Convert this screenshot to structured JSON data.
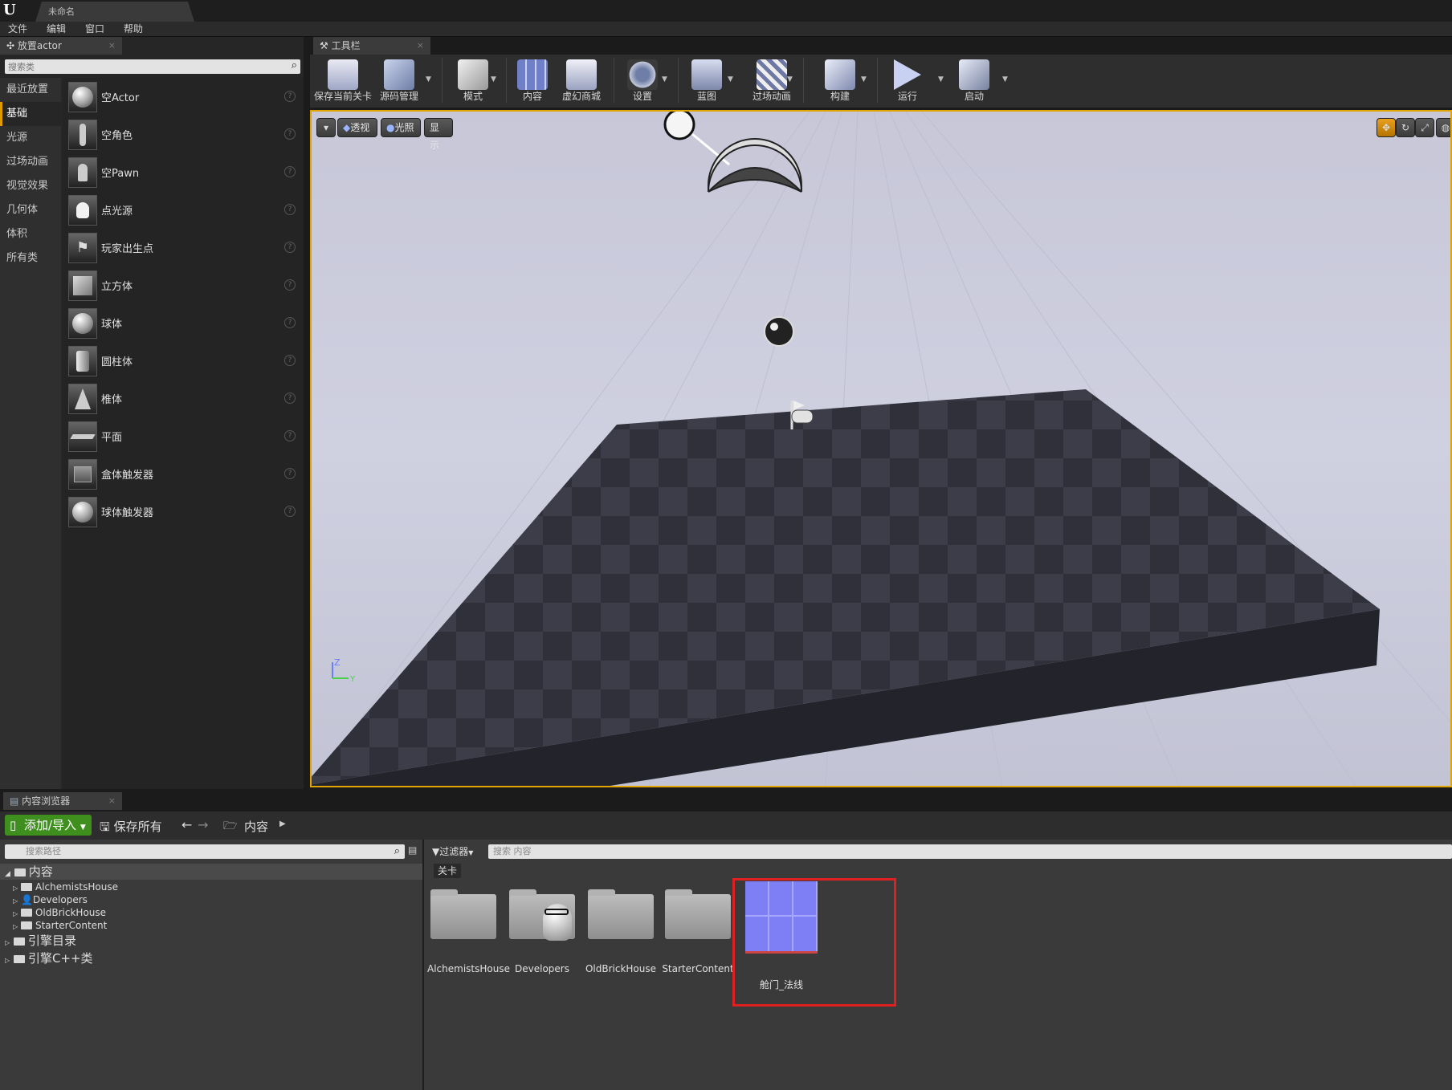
{
  "titlebar": {
    "doc_tab": "未命名"
  },
  "menu": [
    "文件",
    "编辑",
    "窗口",
    "帮助"
  ],
  "place_panel": {
    "tab_label": "放置actor",
    "search_placeholder": "搜索类",
    "categories": [
      "最近放置",
      "基础",
      "光源",
      "过场动画",
      "视觉效果",
      "几何体",
      "体积",
      "所有类"
    ],
    "active_category": "基础",
    "items": [
      "空Actor",
      "空角色",
      "空Pawn",
      "点光源",
      "玩家出生点",
      "立方体",
      "球体",
      "圆柱体",
      "椎体",
      "平面",
      "盒体触发器",
      "球体触发器"
    ]
  },
  "toolbar": {
    "tab_label": "工具栏",
    "buttons": [
      "保存当前关卡",
      "源码管理",
      "模式",
      "内容",
      "虚幻商城",
      "设置",
      "蓝图",
      "过场动画",
      "构建",
      "运行",
      "启动"
    ]
  },
  "viewport": {
    "dropdown_icon": "chevron-down-icon",
    "perspective": "透视",
    "lighting": "光照",
    "show": "显示",
    "axis_z": "Z",
    "axis_y": "Y"
  },
  "content_browser": {
    "tab_label": "内容浏览器",
    "add_import": "添加/导入",
    "save_all": "保存所有",
    "breadcrumb": "内容",
    "path_search_placeholder": "搜索路径",
    "filters_label": "过滤器",
    "content_search_placeholder": "搜索 内容",
    "filter_chip": "关卡",
    "tree": {
      "root": "内容",
      "children": [
        "AlchemistsHouse",
        "Developers",
        "OldBrickHouse",
        "StarterContent"
      ],
      "engine_content": "引擎目录",
      "engine_cpp": "引擎C++类"
    },
    "assets": [
      "AlchemistsHouse",
      "Developers",
      "OldBrickHouse",
      "StarterContent",
      "舱门_法线"
    ],
    "highlight_color": "#e02020"
  }
}
